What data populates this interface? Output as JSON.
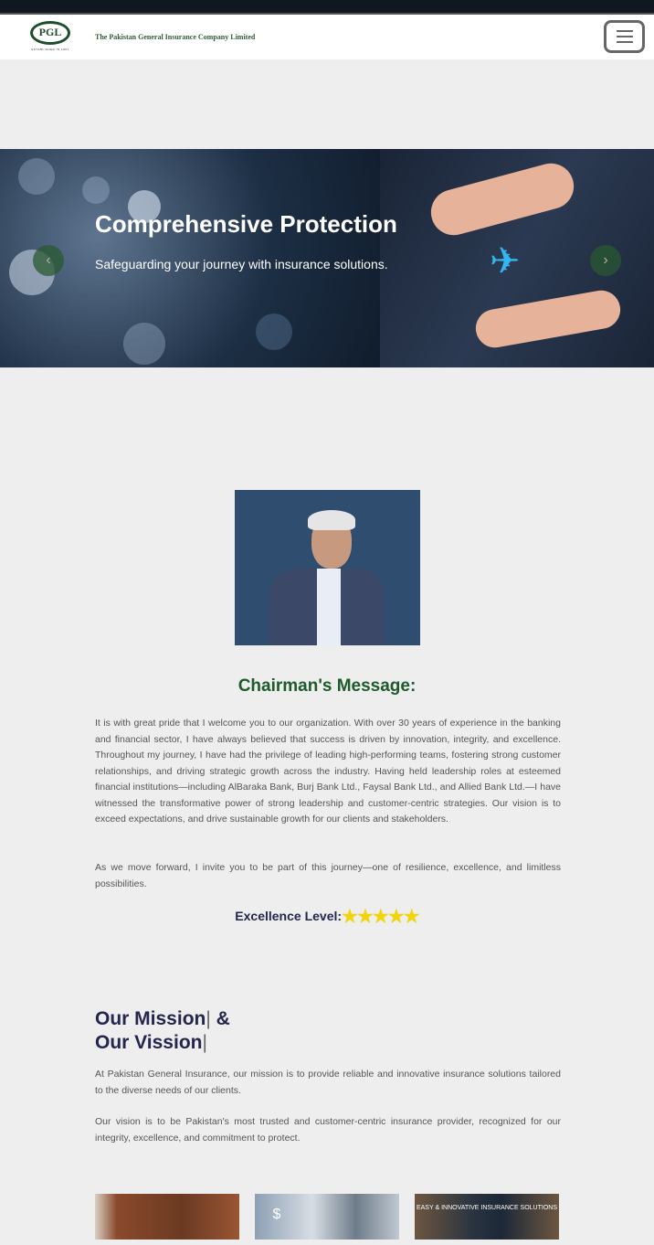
{
  "header": {
    "logo_text": "PGL",
    "logo_tagline": "ESTABLISHED IN 1961",
    "company_name": "The Pakistan General Insurance Company Limited",
    "menu_icon": "hamburger-icon"
  },
  "hero": {
    "title": "Comprehensive Protection",
    "subtitle": "Safeguarding your journey with insurance solutions.",
    "prev_icon": "‹",
    "next_icon": "›"
  },
  "chairman": {
    "title": "Chairman's Message:",
    "paragraphs": [
      "It is with great pride that I welcome you to our organization. With over 30 years of experience in the banking and financial sector, I have always believed that success is driven by innovation, integrity, and excellence. Throughout my journey, I have had the privilege of leading high-performing teams, fostering strong customer relationships, and driving strategic growth across the industry. Having held leadership roles at esteemed financial institutions—including AlBaraka Bank, Burj Bank Ltd., Faysal Bank Ltd., and Allied Bank Ltd.—I have witnessed the transformative power of strong leadership and customer-centric strategies. Our vision is to exceed expectations, and drive sustainable growth for our clients and stakeholders.",
      "As we move forward, I invite you to be part of this journey—one of resilience, excellence, and limitless possibilities."
    ],
    "excellence_label": "Excellence Level:",
    "stars": "★★★★★",
    "rating": 5,
    "star_color": "#f0d50d"
  },
  "mission": {
    "title_line1": "Our Mission",
    "title_amp": "&",
    "title_line2": "Our Vission",
    "caret": "|",
    "paragraphs": [
      "At Pakistan General Insurance, our mission is to provide reliable and innovative insurance solutions tailored to the diverse needs of our clients.",
      "Our vision is to be Pakistan's most trusted and customer-centric insurance provider, recognized for our integrity, excellence, and commitment to protect."
    ]
  },
  "cards": [
    {
      "caption": ""
    },
    {
      "caption": "$"
    },
    {
      "caption": "EASY & INNOVATIVE INSURANCE SOLUTIONS"
    }
  ],
  "colors": {
    "brand_green": "#1e5a2a",
    "navy": "#24264e"
  }
}
